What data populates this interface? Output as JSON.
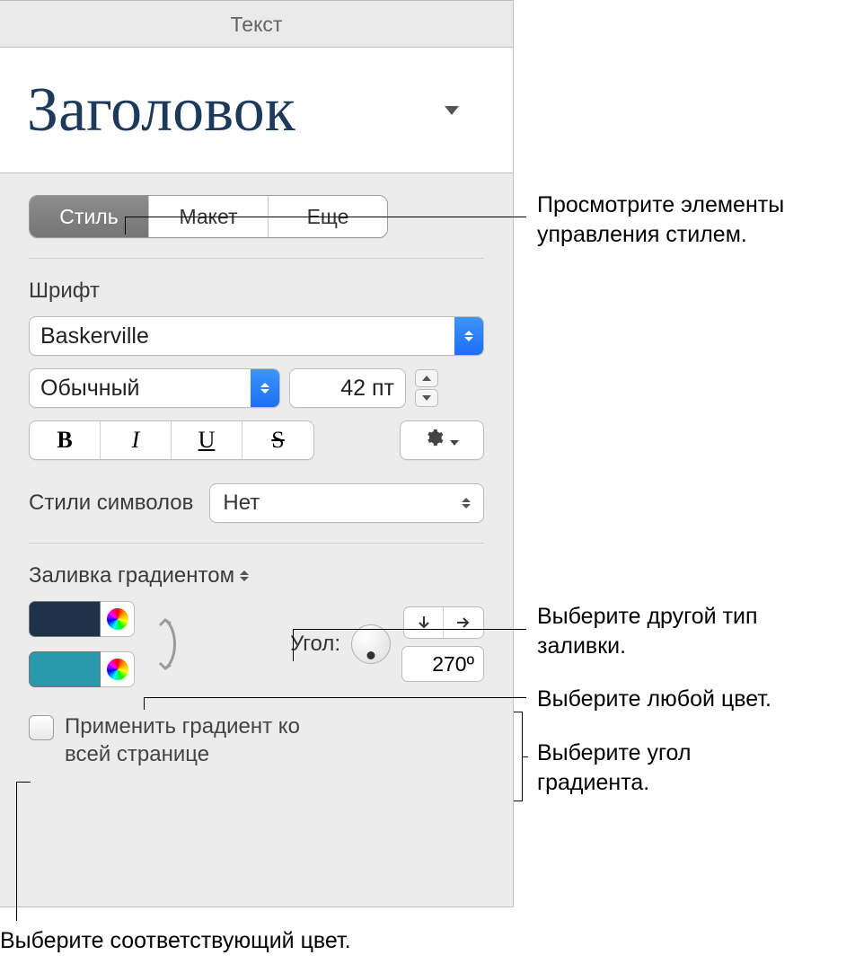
{
  "panel": {
    "header": "Текст",
    "style_name": "Заголовок"
  },
  "tabs": {
    "style": "Стиль",
    "layout": "Макет",
    "more": "Еще"
  },
  "font": {
    "section_label": "Шрифт",
    "family": "Baskerville",
    "weight": "Обычный",
    "size": "42 пт",
    "bold": "B",
    "italic": "I",
    "underline": "U",
    "strike": "S"
  },
  "char_styles": {
    "label": "Стили символов",
    "value": "Нет"
  },
  "fill": {
    "label": "Заливка градиентом",
    "angle_label": "Угол:",
    "angle_value": "270º",
    "color1": "#1e3348",
    "color2": "#2b99ac",
    "apply_whole_page": "Применить градиент ко всей странице"
  },
  "callouts": {
    "style_controls": "Просмотрите элементы управления стилем.",
    "fill_type": "Выберите другой тип заливки.",
    "any_color": "Выберите любой цвет.",
    "gradient_angle": "Выберите угол градиента.",
    "matching_color": "Выберите соответствующий цвет."
  }
}
